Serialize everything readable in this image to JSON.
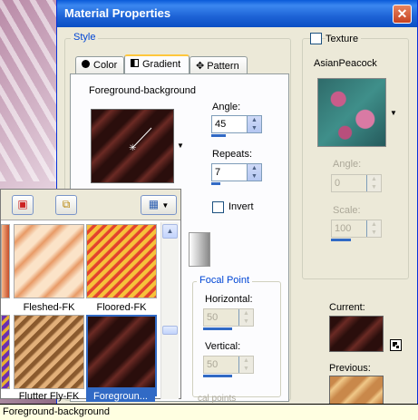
{
  "window": {
    "title": "Material Properties",
    "close": "✕"
  },
  "style": {
    "group_label": "Style",
    "tabs": [
      {
        "label": "Color"
      },
      {
        "label": "Gradient"
      },
      {
        "label": "Pattern"
      }
    ],
    "gradient_name": "Foreground-background",
    "angle_label": "Angle:",
    "angle_value": "45",
    "repeats_label": "Repeats:",
    "repeats_value": "7",
    "invert_label": "Invert",
    "focal_point_label": "Focal Point",
    "horizontal_label": "Horizontal:",
    "horizontal_value": "50",
    "vertical_label": "Vertical:",
    "vertical_value": "50",
    "focal_points_partial": "cal points"
  },
  "texture": {
    "label": "Texture",
    "name": "AsianPeacock",
    "angle_label": "Angle:",
    "angle_value": "0",
    "scale_label": "Scale:",
    "scale_value": "100"
  },
  "current_label": "Current:",
  "previous_label": "Previous:",
  "popup": {
    "items": [
      {
        "label": "Fleshed-FK"
      },
      {
        "label": "Floored-FK"
      },
      {
        "label": "Flutter Fly-FK"
      },
      {
        "label": "Foregroun..."
      }
    ]
  },
  "status_text": "Foreground-background",
  "colors": {
    "title_bar": "#0a5ad8",
    "accent": "#316ac5",
    "selected_tile": "#316ac5"
  }
}
